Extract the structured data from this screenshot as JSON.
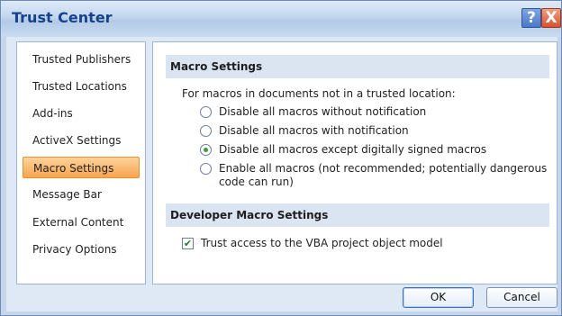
{
  "window": {
    "title": "Trust Center",
    "help_glyph": "?",
    "close_glyph": "X"
  },
  "sidebar": {
    "items": [
      {
        "label": "Trusted Publishers"
      },
      {
        "label": "Trusted Locations"
      },
      {
        "label": "Add-ins"
      },
      {
        "label": "ActiveX Settings"
      },
      {
        "label": "Macro Settings",
        "selected": true
      },
      {
        "label": "Message Bar"
      },
      {
        "label": "External Content"
      },
      {
        "label": "Privacy Options"
      }
    ]
  },
  "macro_settings": {
    "heading": "Macro Settings",
    "intro": "For macros in documents not in a trusted location:",
    "options": [
      {
        "label": "Disable all macros without notification",
        "checked": false
      },
      {
        "label": "Disable all macros with notification",
        "checked": false
      },
      {
        "label": "Disable all macros except digitally signed macros",
        "checked": true
      },
      {
        "label": "Enable all macros (not recommended; potentially dangerous",
        "label_line2": "code can run)",
        "checked": false
      }
    ]
  },
  "developer_settings": {
    "heading": "Developer Macro Settings",
    "trust_vba_label": "Trust access to the VBA project object model",
    "trust_vba_checked": true
  },
  "buttons": {
    "ok": "OK",
    "cancel": "Cancel"
  },
  "colors": {
    "selected_item": "#f7a54f",
    "title_text": "#15428b",
    "radio_dot": "#3c9c3c"
  }
}
